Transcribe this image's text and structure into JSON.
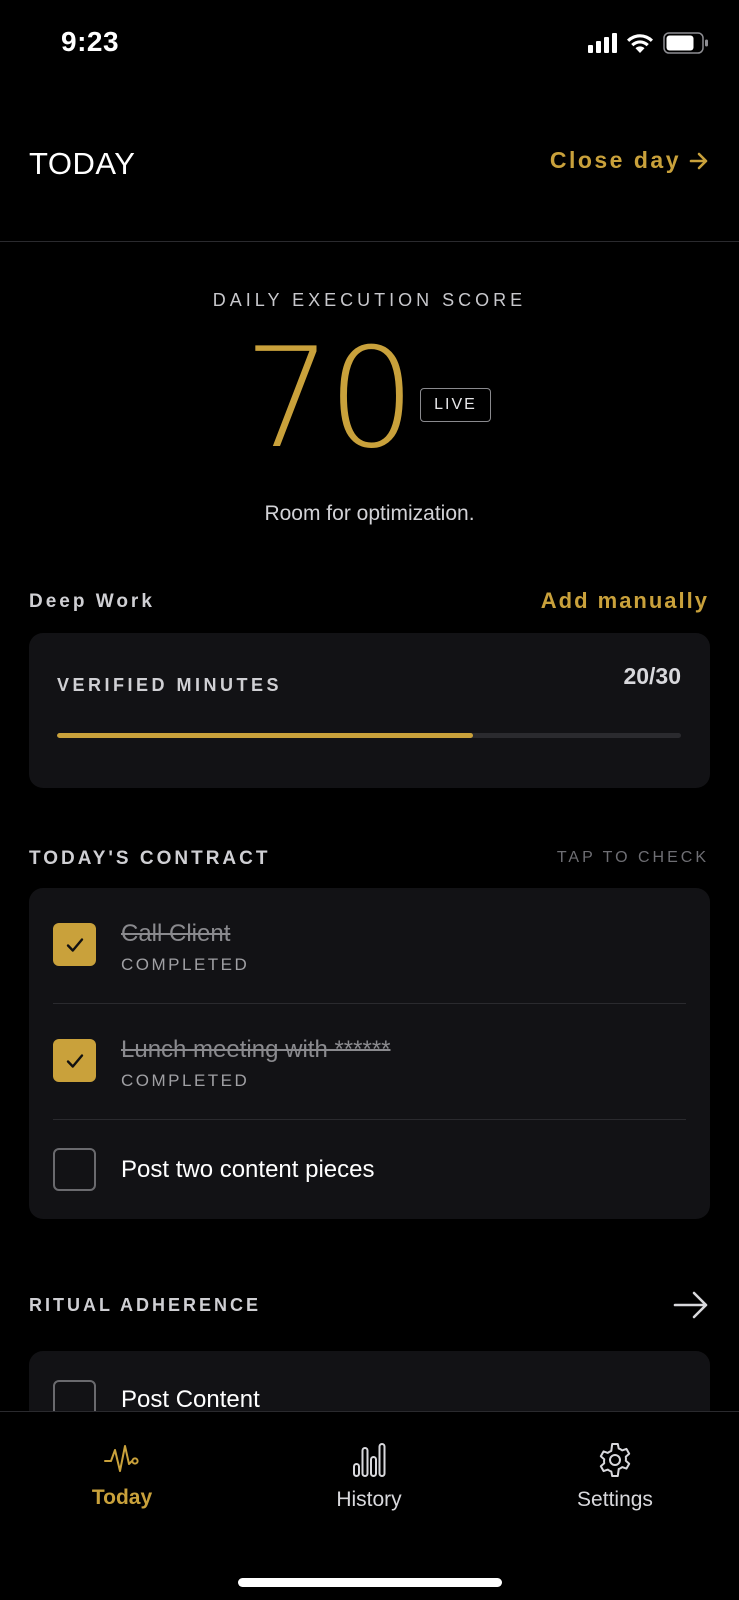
{
  "status_bar": {
    "time": "9:23"
  },
  "header": {
    "title": "TODAY",
    "close_day": "Close day"
  },
  "score": {
    "caption": "DAILY EXECUTION SCORE",
    "value": "70",
    "badge": "LIVE",
    "message": "Room for optimization."
  },
  "deep_work": {
    "section_label": "Deep Work",
    "add_manually": "Add manually",
    "verified_label": "VERIFIED MINUTES",
    "count_text": "20/30",
    "progress_fraction": 0.667
  },
  "contract": {
    "section_label": "TODAY'S CONTRACT",
    "hint": "TAP TO CHECK",
    "tasks": [
      {
        "title": "Call Client",
        "status": "COMPLETED",
        "done": true
      },
      {
        "title": "Lunch meeting with ******",
        "status": "COMPLETED",
        "done": true
      },
      {
        "title": "Post two content pieces",
        "status": "",
        "done": false
      }
    ]
  },
  "ritual": {
    "section_label": "RITUAL ADHERENCE",
    "items": [
      {
        "title": "Post Content",
        "done": false
      }
    ]
  },
  "tabs": [
    {
      "label": "Today",
      "icon": "pulse-icon",
      "active": true
    },
    {
      "label": "History",
      "icon": "bar-chart-icon",
      "active": false
    },
    {
      "label": "Settings",
      "icon": "gear-icon",
      "active": false
    }
  ],
  "colors": {
    "accent": "#c9a13b",
    "background": "#000000",
    "card": "#121215"
  }
}
